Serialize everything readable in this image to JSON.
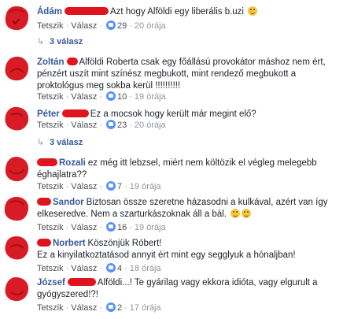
{
  "comments": [
    {
      "name": "Ádám",
      "text": "Azt hogy Alföldi egy liberális b.uzi",
      "emoji": "grinning-sweat-emoji",
      "like_label": "Tetszik",
      "reply_label": "Válasz",
      "likes": "29",
      "time": "20 órája",
      "replies": "3 válasz"
    },
    {
      "name": "Zoltán",
      "text": "Alföldi Roberta csak egy főállású provokátor máshoz nem ért, pénzért uszít mint színész megbukott, mint rendező megbukott a proktológus meg sokba kerül !!!!!!!!!!",
      "like_label": "Tetszik",
      "reply_label": "Válasz",
      "likes": "10",
      "time": "19 órája"
    },
    {
      "name": "Péter",
      "text": "Ez a mocsok hogy került már megint elő?",
      "like_label": "Tetszik",
      "reply_label": "Válasz",
      "likes": "23",
      "time": "20 órája",
      "replies": "3 válasz"
    },
    {
      "name": "Rozali",
      "text": "ez még itt lebzsel, miért nem költözik el végleg melegebb éghajlatra??",
      "like_label": "Tetszik",
      "reply_label": "Válasz",
      "likes": "7",
      "time": "19 órája"
    },
    {
      "name": "Sandor",
      "text": "Biztosan össze szeretne házasodni a kulkával, azért van így elkeseredve. Nem a szarturkászoknak áll a bál.",
      "like_label": "Tetszik",
      "reply_label": "Válasz",
      "likes": "16",
      "time": "19 órája"
    },
    {
      "name": "Norbert",
      "text": "Köszönjük Róbert! Ez a kinyilatkoztatásod annyit ért mint egy segglyuk a hónaljban!",
      "line1": "Köszönjük Róbert!",
      "line2": "Ez a kinyilatkoztatásod annyit ért mint egy segglyuk a hónaljban!",
      "like_label": "Tetszik",
      "reply_label": "Válasz",
      "likes": "4",
      "time": "18 órája"
    },
    {
      "name": "József",
      "text": "Alföldi...! Te gyárilag vagy ekkora idióta, vagy elgurult a gyógyszered!?!",
      "like_label": "Tetszik",
      "reply_label": "Válasz",
      "likes": "2",
      "time": "17 órája"
    }
  ],
  "colors": {
    "redaction": "#e0141c",
    "name": "#365899",
    "like": "#5890ff"
  },
  "icons": [
    "like-icon",
    "reply-arrow-icon",
    "avatar-icon",
    "emoji-icon"
  ]
}
